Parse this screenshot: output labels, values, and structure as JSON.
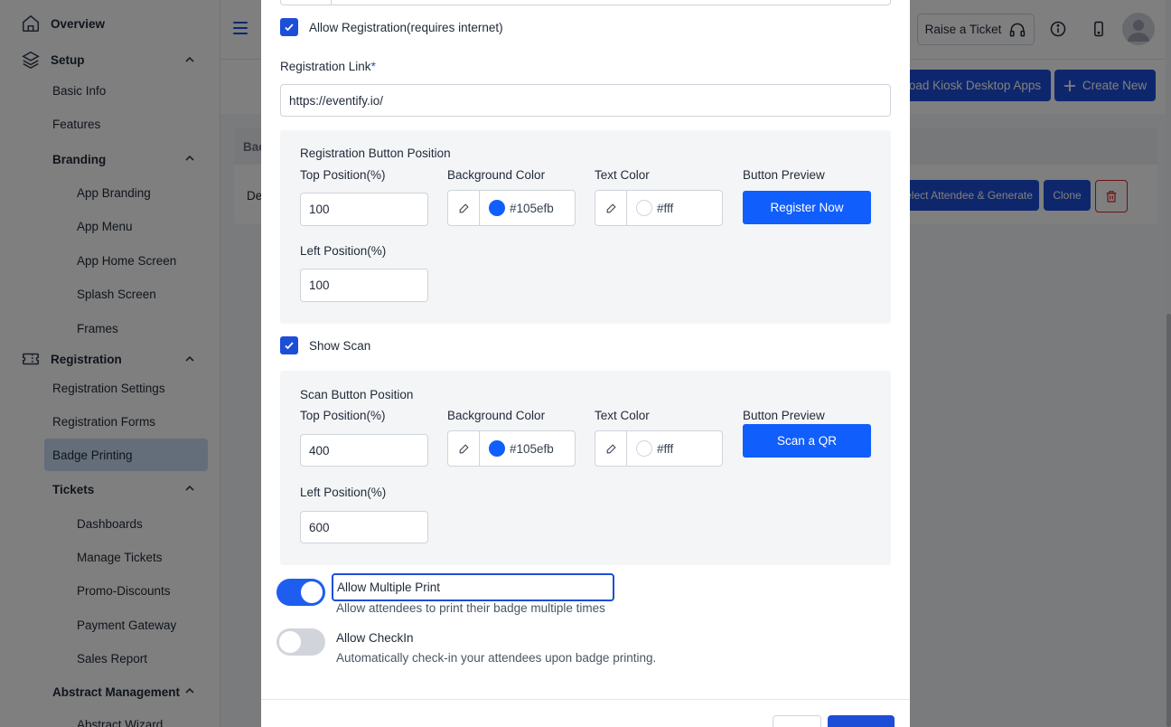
{
  "sidebar": {
    "overview": "Overview",
    "setup": "Setup",
    "basic_info": "Basic Info",
    "features": "Features",
    "branding": "Branding",
    "app_branding": "App Branding",
    "app_menu": "App Menu",
    "app_home_screen": "App Home Screen",
    "splash_screen": "Splash Screen",
    "frames": "Frames",
    "registration": "Registration",
    "registration_settings": "Registration Settings",
    "registration_forms": "Registration Forms",
    "badge_printing": "Badge Printing",
    "tickets": "Tickets",
    "dashboards": "Dashboards",
    "manage_tickets": "Manage Tickets",
    "promo_discounts": "Promo-Discounts",
    "payment_gateway": "Payment Gateway",
    "sales_report": "Sales Report",
    "abstract_management": "Abstract Management",
    "abstract_wizard": "Abstract Wizard"
  },
  "topbar": {
    "raise_ticket": "Raise a Ticket"
  },
  "background": {
    "download_kiosk": "oad Kiosk Desktop Apps",
    "create_new": "Create New",
    "table_header_partial": "Bac",
    "row_partial": "De",
    "select_attendee": "elect Attendee & Generate",
    "clone": "Clone"
  },
  "modal": {
    "allow_registration_label": "Allow Registration(requires internet)",
    "registration_link_label": "Registration Link",
    "registration_link_required": "*",
    "registration_link_value": "https://eventify.io/",
    "reg_panel": {
      "title": "Registration Button Position",
      "top_label": "Top Position(%)",
      "top_value": "100",
      "bg_label": "Background Color",
      "bg_value": "#105efb",
      "text_label": "Text Color",
      "text_value": "#fff",
      "preview_label": "Button Preview",
      "preview_button": "Register Now",
      "left_label": "Left Position(%)",
      "left_value": "100"
    },
    "show_scan_label": "Show Scan",
    "scan_panel": {
      "title": "Scan Button Position",
      "top_label": "Top Position(%)",
      "top_value": "400",
      "bg_label": "Background Color",
      "bg_value": "#105efb",
      "text_label": "Text Color",
      "text_value": "#fff",
      "preview_label": "Button Preview",
      "preview_button": "Scan a QR",
      "left_label": "Left Position(%)",
      "left_value": "600"
    },
    "allow_multiple_print": {
      "value": "Allow Multiple Print",
      "hint": "Allow attendees to print their badge multiple times",
      "enabled": true
    },
    "allow_checkin": {
      "title": "Allow CheckIn",
      "hint": "Automatically check-in your attendees upon badge printing.",
      "enabled": false
    }
  },
  "colors": {
    "primary": "#1d4ed8",
    "preview_bg": "#105efb",
    "toggle_on": "#1d5ef0",
    "toggle_off": "#d1d5db"
  }
}
